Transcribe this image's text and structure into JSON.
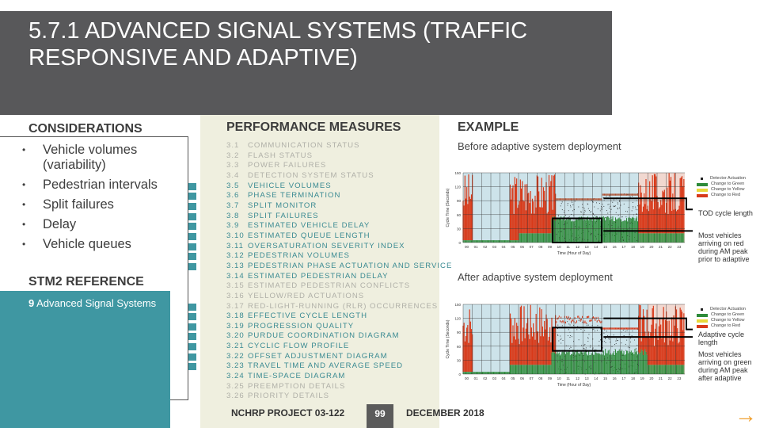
{
  "title": "5.7.1 ADVANCED SIGNAL SYSTEMS (TRAFFIC RESPONSIVE AND ADAPTIVE)",
  "considerations": {
    "heading": "CONSIDERATIONS",
    "items": [
      "Vehicle volumes (variability)",
      "Pedestrian intervals",
      "Split failures",
      "Delay",
      "Vehicle queues"
    ]
  },
  "stm2": {
    "heading": "STM2 REFERENCE",
    "number": "9",
    "text": "Advanced Signal Systems"
  },
  "performance": {
    "heading": "PERFORMANCE MEASURES",
    "items": [
      {
        "num": "3.1",
        "label": "COMMUNICATION STATUS",
        "active": false
      },
      {
        "num": "3.2",
        "label": "FLASH STATUS",
        "active": false
      },
      {
        "num": "3.3",
        "label": "POWER FAILURES",
        "active": false
      },
      {
        "num": "3.4",
        "label": "DETECTION SYSTEM STATUS",
        "active": false
      },
      {
        "num": "3.5",
        "label": "VEHICLE VOLUMES",
        "active": true,
        "marked": true
      },
      {
        "num": "3.6",
        "label": "PHASE TERMINATION",
        "active": true,
        "marked": true
      },
      {
        "num": "3.7",
        "label": "SPLIT MONITOR",
        "active": true,
        "marked": true
      },
      {
        "num": "3.8",
        "label": "SPLIT FAILURES",
        "active": true,
        "marked": true
      },
      {
        "num": "3.9",
        "label": "ESTIMATED VEHICLE DELAY",
        "active": true,
        "marked": true
      },
      {
        "num": "3.10",
        "label": "ESTIMATED QUEUE LENGTH",
        "active": true,
        "marked": true
      },
      {
        "num": "3.11",
        "label": "OVERSATURATION SEVERITY INDEX",
        "active": true,
        "marked": true
      },
      {
        "num": "3.12",
        "label": "PEDESTRIAN VOLUMES",
        "active": true,
        "marked": true
      },
      {
        "num": "3.13",
        "label": "PEDESTRIAN PHASE ACTUATION AND SERVICE",
        "active": true,
        "marked": true
      },
      {
        "num": "3.14",
        "label": "ESTIMATED PEDESTRIAN DELAY",
        "active": true,
        "marked": false
      },
      {
        "num": "3.15",
        "label": "ESTIMATED PEDESTRIAN CONFLICTS",
        "active": false
      },
      {
        "num": "3.16",
        "label": "YELLOW/RED ACTUATIONS",
        "active": false
      },
      {
        "num": "3.17",
        "label": "RED-LIGHT-RUNNING (RLR) OCCURRENCES",
        "active": false,
        "marked": true
      },
      {
        "num": "3.18",
        "label": "EFFECTIVE CYCLE LENGTH",
        "active": true,
        "marked": true
      },
      {
        "num": "3.19",
        "label": "PROGRESSION QUALITY",
        "active": true,
        "marked": true
      },
      {
        "num": "3.20",
        "label": "PURDUE COORDINATION DIAGRAM",
        "active": true,
        "marked": true
      },
      {
        "num": "3.21",
        "label": "CYCLIC FLOW PROFILE",
        "active": true,
        "marked": true
      },
      {
        "num": "3.22",
        "label": "OFFSET ADJUSTMENT DIAGRAM",
        "active": true,
        "marked": true
      },
      {
        "num": "3.23",
        "label": "TRAVEL TIME AND AVERAGE SPEED",
        "active": true,
        "marked": true
      },
      {
        "num": "3.24",
        "label": "TIME-SPACE DIAGRAM",
        "active": true,
        "marked": false
      },
      {
        "num": "3.25",
        "label": "PREEMPTION DETAILS",
        "active": false
      },
      {
        "num": "3.26",
        "label": "PRIORITY DETAILS",
        "active": false
      }
    ]
  },
  "example": {
    "heading": "EXAMPLE",
    "before_label": "Before adaptive system deployment",
    "after_label": "After adaptive system deployment",
    "before_annotations": [
      "TOD cycle length",
      "Most vehicles arriving on red during AM peak prior to adaptive"
    ],
    "after_annotations": [
      "Adaptive cycle length",
      "Most vehicles arriving on green during AM peak after adaptive"
    ],
    "legend": [
      "Detector Actuation",
      "Change to Green",
      "Change to Yellow",
      "Change to Red"
    ],
    "colors": {
      "detector": "#222222",
      "green": "#2e8b3a",
      "yellow": "#e8d83a",
      "red": "#d83a1a",
      "sky": "#cde3ea"
    },
    "ylabel": "Cycle Time (Seconds)",
    "xlabel": "Time (Hour of Day)",
    "yticks": [
      "0",
      "30",
      "60",
      "90",
      "120",
      "150"
    ],
    "xticks": [
      "00",
      "01",
      "02",
      "03",
      "04",
      "05",
      "06",
      "07",
      "08",
      "09",
      "10",
      "11",
      "12",
      "13",
      "14",
      "15",
      "16",
      "17",
      "18",
      "19",
      "20",
      "21",
      "22",
      "23"
    ]
  },
  "footer": {
    "project": "NCHRP PROJECT 03-122",
    "page": "99",
    "date": "DECEMBER 2018"
  },
  "next_icon": "arrow-right-icon"
}
